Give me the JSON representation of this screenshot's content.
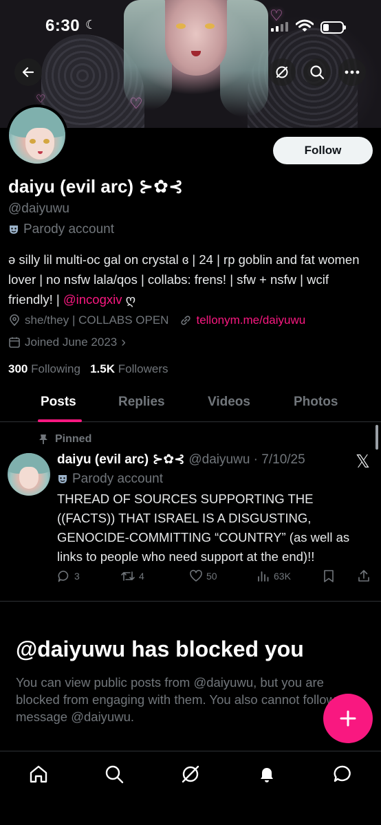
{
  "status_bar": {
    "time": "6:30"
  },
  "profile": {
    "follow_label": "Follow",
    "display_name": "daiyu (evil arc) ⊱✿⊰",
    "handle": "@daiyuwu",
    "parody_label": "Parody account",
    "bio_text": "ə silly lil multi-oc gal on crystal ɞ | 24 | rp goblin and fat women lover | no nsfw lala/qos | collabs: frens! | sfw + nsfw | wcif friendly! | ",
    "bio_mention": "@incogxiv",
    "bio_end": " ღ",
    "pronouns": "she/they | COLLABS OPEN",
    "link": "tellonym.me/daiyuwu",
    "joined": "Joined June 2023",
    "following_count": "300",
    "following_label": "Following",
    "followers_count": "1.5K",
    "followers_label": "Followers"
  },
  "tabs": [
    "Posts",
    "Replies",
    "Videos",
    "Photos"
  ],
  "active_tab": "Posts",
  "pinned_tweet": {
    "pinned_label": "Pinned",
    "author_name": "daiyu (evil arc) ⊱✿⊰",
    "author_handle": "@daiyuwu",
    "date": "7/10/25",
    "parody_label": "Parody account",
    "text": "THREAD OF SOURCES SUPPORTING THE ((FACTS)) THAT ISRAEL IS A DISGUSTING, GENOCIDE-COMMITTING “COUNTRY” (as well as links to people who need support at the end)!!",
    "replies": "3",
    "reposts": "4",
    "likes": "50",
    "views": "63K"
  },
  "blocked": {
    "title": "@daiyuwu has blocked you",
    "message": "You can view public posts from @daiyuwu, but you are blocked from engaging with them. You also cannot follow or message @daiyuwu."
  },
  "icons": {
    "back": "back-arrow-icon",
    "grok": "grok-icon",
    "search": "search-icon",
    "more": "more-icon",
    "compose": "plus-icon",
    "nav": [
      "home-icon",
      "search-icon",
      "grok-icon",
      "notifications-icon",
      "messages-icon"
    ]
  },
  "colors": {
    "accent": "#f91880",
    "background": "#000000",
    "secondary_text": "#71767b",
    "follow_button": "#eff3f4"
  }
}
